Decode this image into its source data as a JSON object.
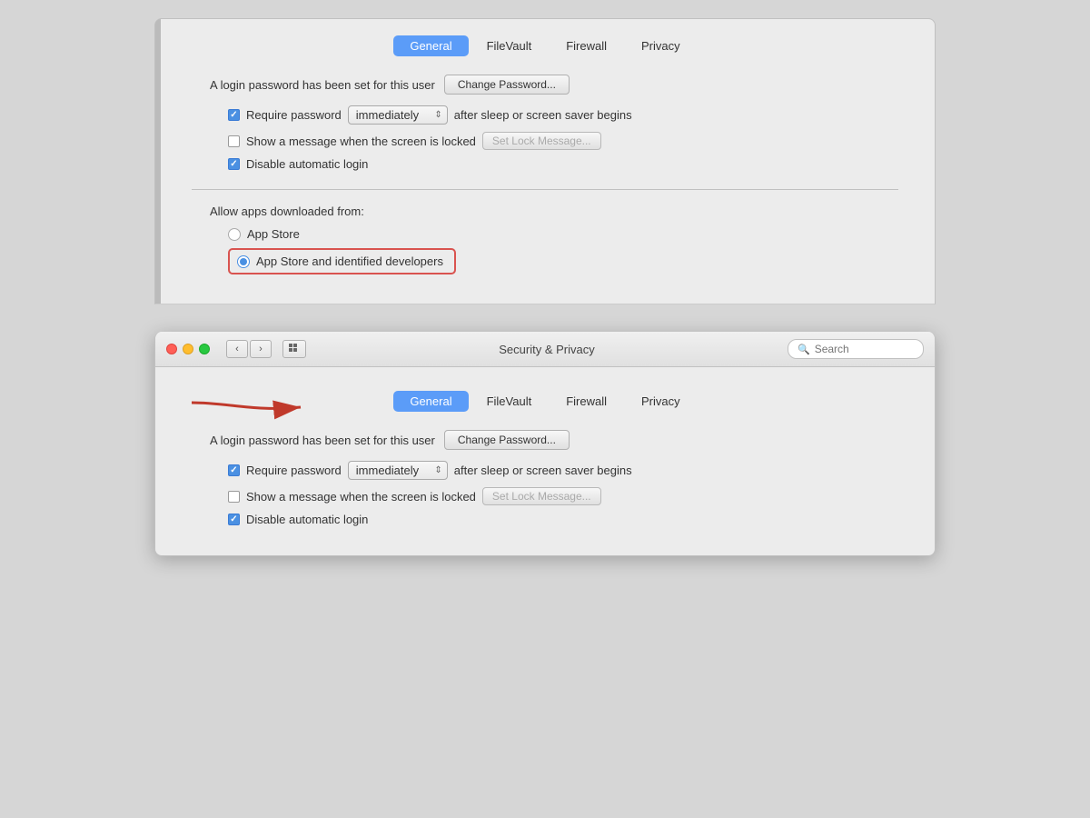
{
  "top_panel": {
    "tabs": [
      {
        "id": "general",
        "label": "General",
        "active": true
      },
      {
        "id": "filevault",
        "label": "FileVault",
        "active": false
      },
      {
        "id": "firewall",
        "label": "Firewall",
        "active": false
      },
      {
        "id": "privacy",
        "label": "Privacy",
        "active": false
      }
    ],
    "password_section": {
      "label": "A login password has been set for this user",
      "change_button": "Change Password..."
    },
    "options": [
      {
        "id": "require-password",
        "checked": true,
        "label_before": "Require password",
        "dropdown_value": "immediately",
        "label_after": "after sleep or screen saver begins"
      },
      {
        "id": "show-message",
        "checked": false,
        "label": "Show a message when the screen is locked",
        "lock_button": "Set Lock Message..."
      },
      {
        "id": "disable-login",
        "checked": true,
        "label": "Disable automatic login"
      }
    ],
    "allow_apps": {
      "label": "Allow apps downloaded from:",
      "options": [
        {
          "id": "app-store-only",
          "label": "App Store",
          "selected": false
        },
        {
          "id": "app-store-identified",
          "label": "App Store and identified developers",
          "selected": true,
          "highlighted": true
        }
      ]
    }
  },
  "bottom_window": {
    "title": "Security & Privacy",
    "search_placeholder": "Search",
    "nav": {
      "back": "‹",
      "forward": "›",
      "grid": "⊞"
    },
    "tabs": [
      {
        "id": "general",
        "label": "General",
        "active": true
      },
      {
        "id": "filevault",
        "label": "FileVault",
        "active": false
      },
      {
        "id": "firewall",
        "label": "Firewall",
        "active": false
      },
      {
        "id": "privacy",
        "label": "Privacy",
        "active": false
      }
    ],
    "password_section": {
      "label": "A login password has been set for this user",
      "change_button": "Change Password..."
    },
    "options": [
      {
        "id": "require-password-b",
        "checked": true,
        "label_before": "Require password",
        "dropdown_value": "immediately",
        "label_after": "after sleep or screen saver begins"
      },
      {
        "id": "show-message-b",
        "checked": false,
        "label": "Show a message when the screen is locked",
        "lock_button": "Set Lock Message..."
      },
      {
        "id": "disable-login-b",
        "checked": true,
        "label": "Disable automatic login"
      }
    ]
  }
}
